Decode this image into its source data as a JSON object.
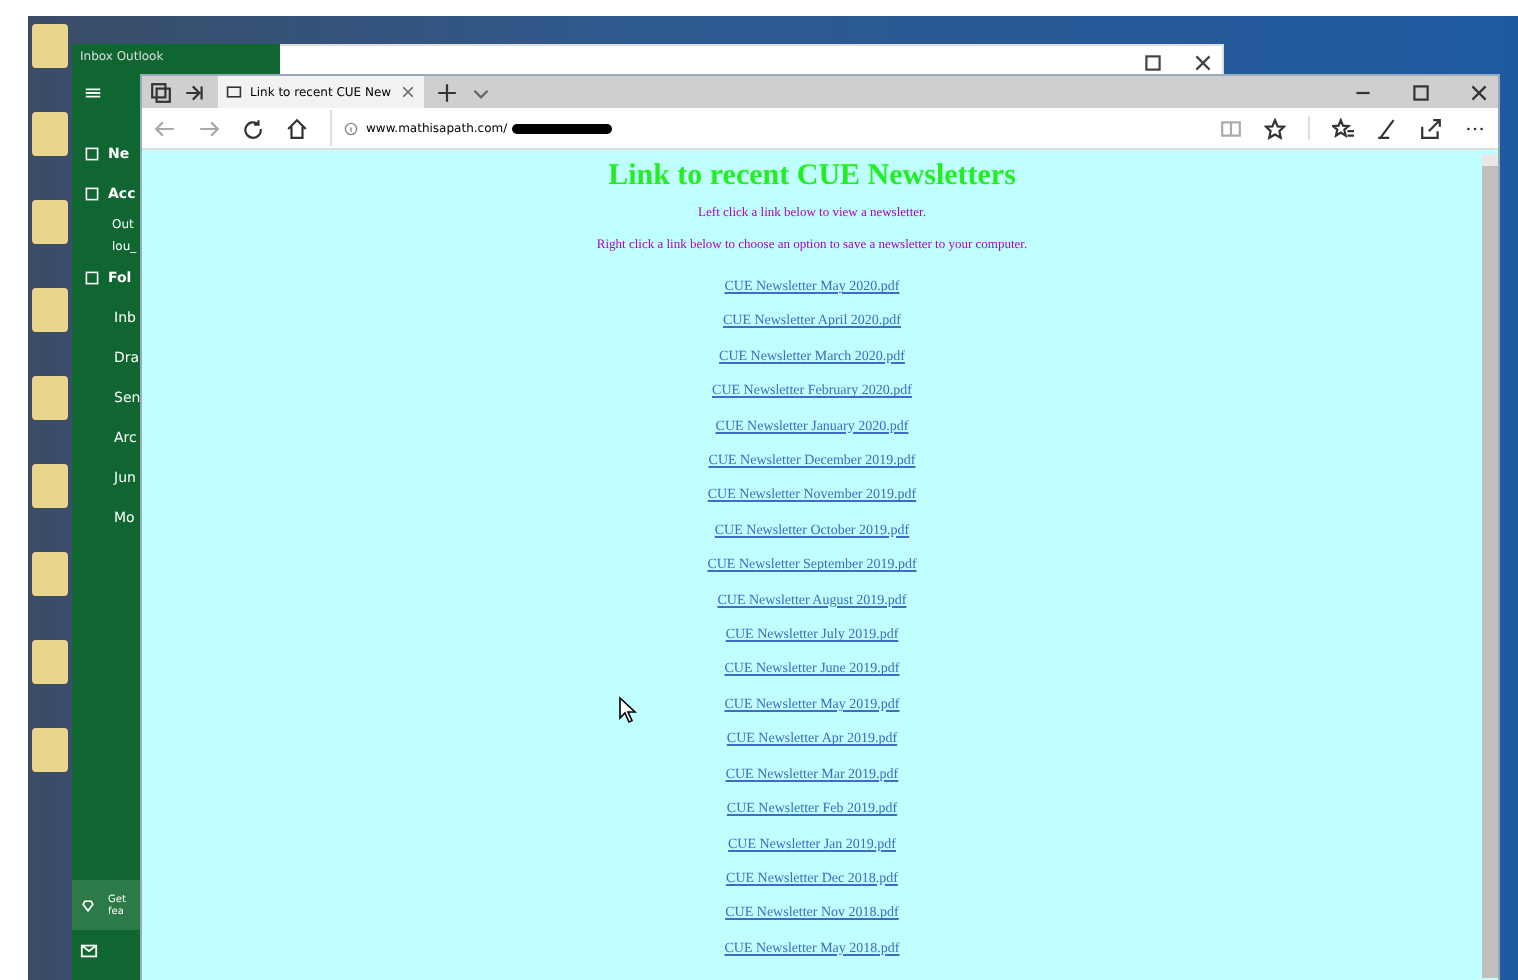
{
  "outlook": {
    "title": "Inbox  Outlook",
    "nav": [
      {
        "kind": "action",
        "label": "Ne"
      },
      {
        "kind": "action",
        "label": "Acc"
      },
      {
        "kind": "account",
        "label": "Out"
      },
      {
        "kind": "account",
        "label": "lou_"
      },
      {
        "kind": "action",
        "label": "Fol"
      },
      {
        "kind": "folder",
        "label": "Inb"
      },
      {
        "kind": "folder",
        "label": "Dra"
      },
      {
        "kind": "folder",
        "label": "Sen"
      },
      {
        "kind": "folder",
        "label": "Arc"
      },
      {
        "kind": "folder",
        "label": "Jun"
      },
      {
        "kind": "folder",
        "label": "Mo"
      }
    ],
    "promo": [
      "Get",
      "fea"
    ]
  },
  "browser": {
    "tab": {
      "title": "Link to recent CUE New",
      "selected": true
    },
    "url": "www.mathisapath.com/"
  },
  "page": {
    "title": "Link to recent CUE Newsletters",
    "instructions": [
      "Left click a link below to view a newsletter.",
      "Right click a link below to choose an option to save a newsletter to your computer."
    ],
    "links": [
      "CUE Newsletter May 2020.pdf",
      "CUE Newsletter April 2020.pdf",
      "CUE Newsletter March 2020.pdf",
      "CUE Newsletter February 2020.pdf",
      "CUE Newsletter January 2020.pdf",
      "CUE Newsletter December 2019.pdf",
      "CUE Newsletter November 2019.pdf",
      "CUE Newsletter October 2019.pdf",
      "CUE Newsletter September 2019.pdf",
      "CUE Newsletter August 2019.pdf",
      "CUE Newsletter July 2019.pdf",
      "CUE Newsletter June 2019.pdf",
      "CUE Newsletter May 2019.pdf",
      "CUE Newsletter Apr 2019.pdf",
      "CUE Newsletter Mar 2019.pdf",
      "CUE Newsletter Feb 2019.pdf",
      "CUE Newsletter Jan 2019.pdf",
      "CUE Newsletter Dec 2018.pdf",
      "CUE Newsletter Nov 2018.pdf",
      "CUE Newsletter May 2018.pdf"
    ]
  }
}
